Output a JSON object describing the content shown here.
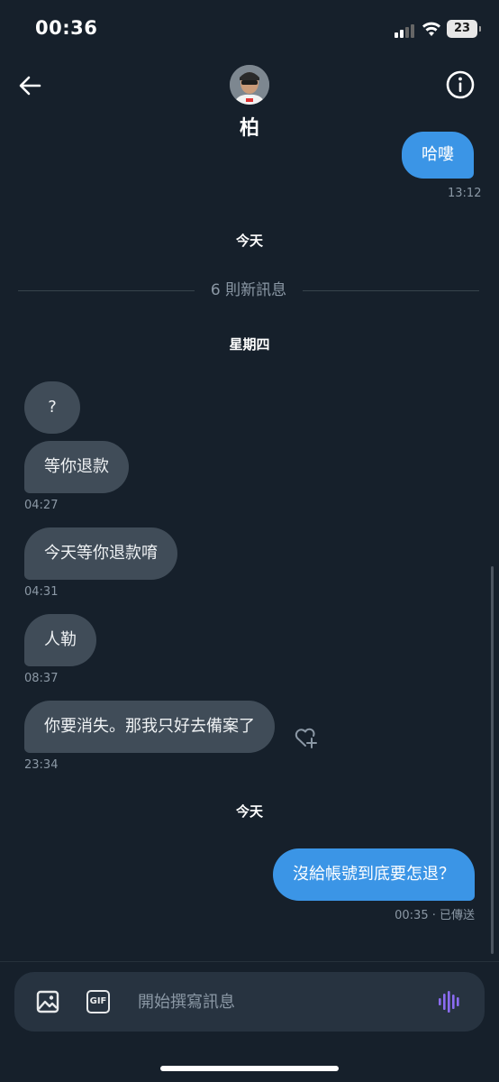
{
  "status_bar": {
    "time": "00:36",
    "battery": "23"
  },
  "header": {
    "contact_name": "柏"
  },
  "messages": [
    {
      "direction": "out",
      "text": "哈嘍",
      "timestamp": "13:12"
    },
    {
      "direction": "in",
      "text": "?"
    },
    {
      "direction": "in",
      "text": "等你退款",
      "timestamp": "04:27"
    },
    {
      "direction": "in",
      "text": "今天等你退款唷",
      "timestamp": "04:31"
    },
    {
      "direction": "in",
      "text": "人勒",
      "timestamp": "08:37"
    },
    {
      "direction": "in",
      "text": "你要消失。那我只好去備案了",
      "timestamp": "23:34"
    },
    {
      "direction": "out",
      "text": "沒給帳號到底要怎退？",
      "timestamp": "00:35 · 已傳送"
    }
  ],
  "labels": {
    "today_top": "今天",
    "new_messages": "6 則新訊息",
    "thursday": "星期四",
    "today_bottom": "今天"
  },
  "composer": {
    "placeholder": "開始撰寫訊息",
    "gif_label": "GIF"
  },
  "colors": {
    "background": "#16202b",
    "incoming_bubble": "#404c58",
    "outgoing_bubble": "#3b95e6",
    "voice_accent": "#8b6cf2"
  }
}
